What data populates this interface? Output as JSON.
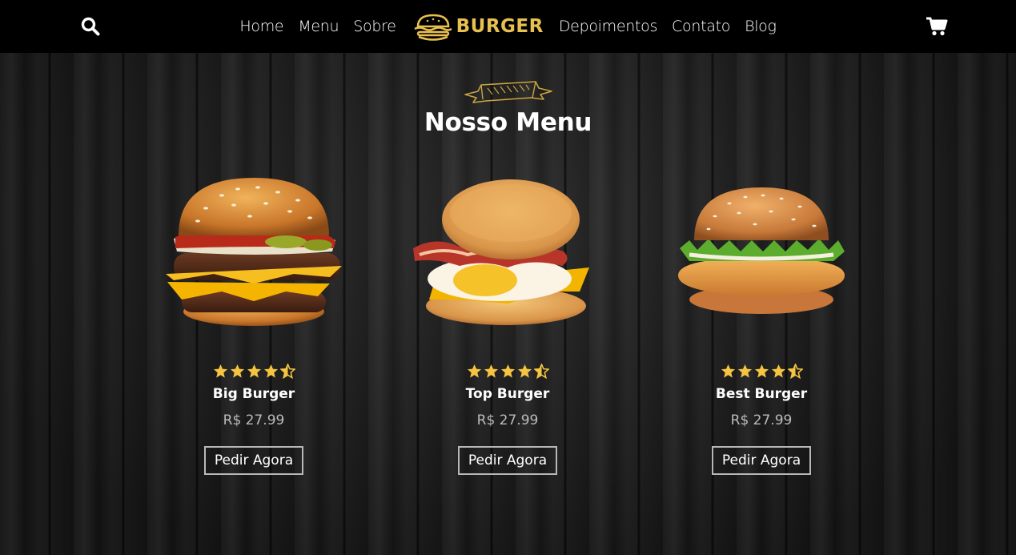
{
  "nav": {
    "links_left": [
      "Home",
      "Menu",
      "Sobre"
    ],
    "logo_text": "BURGER",
    "links_right": [
      "Depoimentos",
      "Contato",
      "Blog"
    ]
  },
  "section": {
    "title": "Nosso Menu"
  },
  "rating_stars": 4.5,
  "products": [
    {
      "name": "Big Burger",
      "price": "R$ 27.99",
      "cta": "Pedir Agora",
      "rating": 4.5
    },
    {
      "name": "Top Burger",
      "price": "R$ 27.99",
      "cta": "Pedir Agora",
      "rating": 4.5
    },
    {
      "name": "Best Burger",
      "price": "R$ 27.99",
      "cta": "Pedir Agora",
      "rating": 4.5
    }
  ],
  "colors": {
    "accent": "#e8c04f",
    "nav_bg": "#000000",
    "star": "#f5c542"
  },
  "icons": {
    "search": "search-icon",
    "cart": "cart-icon",
    "logo": "burger-logo-icon",
    "ribbon": "ribbon-icon",
    "star": "star-icon"
  }
}
